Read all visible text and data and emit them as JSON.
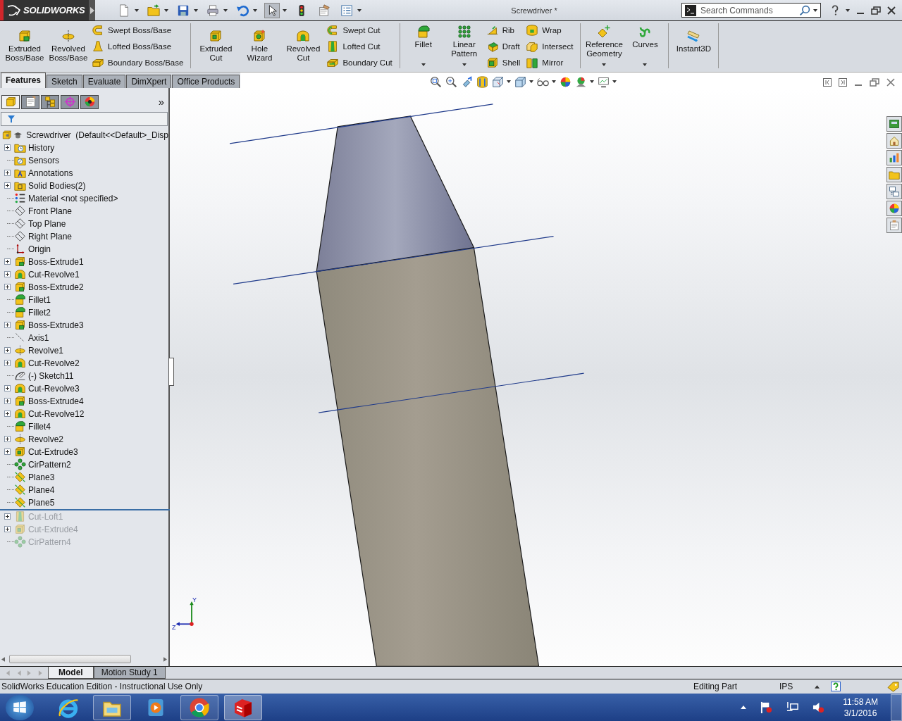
{
  "title_bar": {
    "logo": "SOLIDWORKS",
    "quick_access": [
      {
        "kind": "new",
        "dropdown": true,
        "selected": false
      },
      {
        "kind": "open",
        "dropdown": true,
        "selected": false
      },
      {
        "kind": "save",
        "dropdown": true,
        "selected": false
      },
      {
        "kind": "print",
        "dropdown": true,
        "selected": false
      },
      {
        "kind": "undo",
        "dropdown": true,
        "selected": false
      },
      {
        "kind": "select",
        "dropdown": true,
        "selected": true
      },
      {
        "kind": "rebuild",
        "dropdown": false,
        "selected": false
      },
      {
        "kind": "options",
        "dropdown": false,
        "selected": false
      },
      {
        "kind": "list",
        "dropdown": true,
        "selected": false
      }
    ],
    "title": "Screwdriver *",
    "search": {
      "placeholder": "Search Commands"
    }
  },
  "ribbon": {
    "groups": [
      {
        "large": [
          {
            "kind": "extrude",
            "label": "Extruded Boss/Base",
            "dropdown": false
          },
          {
            "kind": "revolve",
            "label": "Revolved Boss/Base",
            "dropdown": false
          }
        ],
        "stacks": [
          [
            {
              "kind": "sweep",
              "label": "Swept Boss/Base"
            },
            {
              "kind": "loft",
              "label": "Lofted Boss/Base"
            },
            {
              "kind": "boundary",
              "label": "Boundary Boss/Base"
            }
          ]
        ]
      },
      {
        "large": [
          {
            "kind": "cutextrude",
            "label": "Extruded Cut",
            "dropdown": false
          },
          {
            "kind": "hole",
            "label": "Hole Wizard",
            "dropdown": false
          },
          {
            "kind": "cutrevolve",
            "label": "Revolved Cut",
            "dropdown": false
          }
        ],
        "stacks": [
          [
            {
              "kind": "cutsweep",
              "label": "Swept Cut"
            },
            {
              "kind": "cutloft",
              "label": "Lofted Cut"
            },
            {
              "kind": "cutboundary",
              "label": "Boundary Cut"
            }
          ]
        ]
      },
      {
        "large": [
          {
            "kind": "fillet",
            "label": "Fillet",
            "dropdown": true
          },
          {
            "kind": "pattern",
            "label": "Linear Pattern",
            "dropdown": true
          }
        ],
        "stacks": [
          [
            {
              "kind": "rib",
              "label": "Rib"
            },
            {
              "kind": "draft",
              "label": "Draft"
            },
            {
              "kind": "shell",
              "label": "Shell"
            }
          ],
          [
            {
              "kind": "wrap",
              "label": "Wrap"
            },
            {
              "kind": "intersect",
              "label": "Intersect"
            },
            {
              "kind": "mirror",
              "label": "Mirror"
            }
          ]
        ]
      },
      {
        "large": [
          {
            "kind": "refgeom",
            "label": "Reference Geometry",
            "dropdown": true
          },
          {
            "kind": "curves",
            "label": "Curves",
            "dropdown": true
          }
        ]
      },
      {
        "large": [
          {
            "kind": "instant3d",
            "label": "Instant3D",
            "dropdown": false
          }
        ]
      }
    ]
  },
  "tabs": [
    {
      "label": "Features",
      "selected": true
    },
    {
      "label": "Sketch",
      "selected": false
    },
    {
      "label": "Evaluate",
      "selected": false
    },
    {
      "label": "DimXpert",
      "selected": false
    },
    {
      "label": "Office Products",
      "selected": false
    }
  ],
  "panel": {
    "tabs": [
      {
        "kind": "tree",
        "selected": true
      },
      {
        "kind": "property",
        "selected": false
      },
      {
        "kind": "config",
        "selected": false
      },
      {
        "kind": "dimxpert",
        "selected": false
      },
      {
        "kind": "display",
        "selected": false
      }
    ],
    "more": "»",
    "root": {
      "kind": "part",
      "label": "Screwdriver  (Default<<Default>_Disp"
    },
    "items": [
      {
        "kind": "history",
        "label": "History",
        "expandable": true,
        "suppressed": false
      },
      {
        "kind": "sensors",
        "label": "Sensors",
        "expandable": false,
        "suppressed": false
      },
      {
        "kind": "annotations",
        "label": "Annotations",
        "expandable": true,
        "suppressed": false
      },
      {
        "kind": "bodies",
        "label": "Solid Bodies(2)",
        "expandable": true,
        "suppressed": false
      },
      {
        "kind": "material",
        "label": "Material <not specified>",
        "expandable": false,
        "suppressed": false
      },
      {
        "kind": "plane",
        "label": "Front Plane",
        "expandable": false,
        "suppressed": false
      },
      {
        "kind": "plane",
        "label": "Top Plane",
        "expandable": false,
        "suppressed": false
      },
      {
        "kind": "plane",
        "label": "Right Plane",
        "expandable": false,
        "suppressed": false
      },
      {
        "kind": "origin",
        "label": "Origin",
        "expandable": false,
        "suppressed": false
      },
      {
        "kind": "extrude",
        "label": "Boss-Extrude1",
        "expandable": true,
        "suppressed": false
      },
      {
        "kind": "cutrevolve",
        "label": "Cut-Revolve1",
        "expandable": true,
        "suppressed": false
      },
      {
        "kind": "extrude",
        "label": "Boss-Extrude2",
        "expandable": true,
        "suppressed": false
      },
      {
        "kind": "fillet",
        "label": "Fillet1",
        "expandable": false,
        "suppressed": false
      },
      {
        "kind": "fillet",
        "label": "Fillet2",
        "expandable": false,
        "suppressed": false
      },
      {
        "kind": "extrude",
        "label": "Boss-Extrude3",
        "expandable": true,
        "suppressed": false
      },
      {
        "kind": "axis",
        "label": "Axis1",
        "expandable": false,
        "suppressed": false
      },
      {
        "kind": "revolve",
        "label": "Revolve1",
        "expandable": true,
        "suppressed": false
      },
      {
        "kind": "cutrevolve",
        "label": "Cut-Revolve2",
        "expandable": true,
        "suppressed": false
      },
      {
        "kind": "sketch",
        "label": "(-) Sketch11",
        "expandable": false,
        "suppressed": false
      },
      {
        "kind": "cutrevolve",
        "label": "Cut-Revolve3",
        "expandable": true,
        "suppressed": false
      },
      {
        "kind": "extrude",
        "label": "Boss-Extrude4",
        "expandable": true,
        "suppressed": false
      },
      {
        "kind": "cutrevolve",
        "label": "Cut-Revolve12",
        "expandable": true,
        "suppressed": false
      },
      {
        "kind": "fillet",
        "label": "Fillet4",
        "expandable": false,
        "suppressed": false
      },
      {
        "kind": "revolve",
        "label": "Revolve2",
        "expandable": true,
        "suppressed": false
      },
      {
        "kind": "cutextrude",
        "label": "Cut-Extrude3",
        "expandable": true,
        "suppressed": false
      },
      {
        "kind": "cirpattern",
        "label": "CirPattern2",
        "expandable": false,
        "suppressed": false
      },
      {
        "kind": "refplane",
        "label": "Plane3",
        "expandable": false,
        "suppressed": false
      },
      {
        "kind": "refplane",
        "label": "Plane4",
        "expandable": false,
        "suppressed": false
      },
      {
        "kind": "refplane",
        "label": "Plane5",
        "expandable": false,
        "suppressed": false
      },
      {
        "kind": "cutloft",
        "label": "Cut-Loft1",
        "expandable": true,
        "suppressed": true
      },
      {
        "kind": "cutextrude",
        "label": "Cut-Extrude4",
        "expandable": true,
        "suppressed": true
      },
      {
        "kind": "cirpattern",
        "label": "CirPattern4",
        "expandable": false,
        "suppressed": true
      }
    ]
  },
  "viewport": {
    "heads_up": [
      {
        "kind": "zoomfit",
        "dropdown": false
      },
      {
        "kind": "zoomarea",
        "dropdown": false
      },
      {
        "kind": "prevview",
        "dropdown": false
      },
      {
        "kind": "section",
        "dropdown": false
      },
      {
        "kind": "orient",
        "dropdown": true
      },
      {
        "kind": "displaystyle",
        "dropdown": true
      },
      {
        "kind": "hideshow",
        "dropdown": true
      },
      {
        "kind": "appearance",
        "dropdown": false
      },
      {
        "kind": "scene",
        "dropdown": true
      },
      {
        "kind": "viewsettings",
        "dropdown": true
      }
    ],
    "task_pane": [
      {
        "kind": "resources"
      },
      {
        "kind": "library"
      },
      {
        "kind": "fileexplorer"
      },
      {
        "kind": "folder"
      },
      {
        "kind": "palette"
      },
      {
        "kind": "appearances"
      },
      {
        "kind": "properties"
      }
    ],
    "triad": {
      "y": "Y",
      "z": "Z"
    }
  },
  "bottom_tabs": [
    {
      "label": "Model",
      "selected": true
    },
    {
      "label": "Motion Study 1",
      "selected": false
    }
  ],
  "status_bar": {
    "message": "SolidWorks Education Edition - Instructional Use Only",
    "mode": "Editing Part",
    "units": "IPS"
  },
  "taskbar": {
    "apps": [
      {
        "kind": "ie",
        "open": false,
        "selected": false
      },
      {
        "kind": "explorer",
        "open": true,
        "selected": false
      },
      {
        "kind": "media",
        "open": false,
        "selected": false
      },
      {
        "kind": "chrome",
        "open": true,
        "selected": false
      },
      {
        "kind": "solidworks",
        "open": true,
        "selected": true
      }
    ],
    "time": "11:58 AM",
    "date": "3/1/2016"
  }
}
